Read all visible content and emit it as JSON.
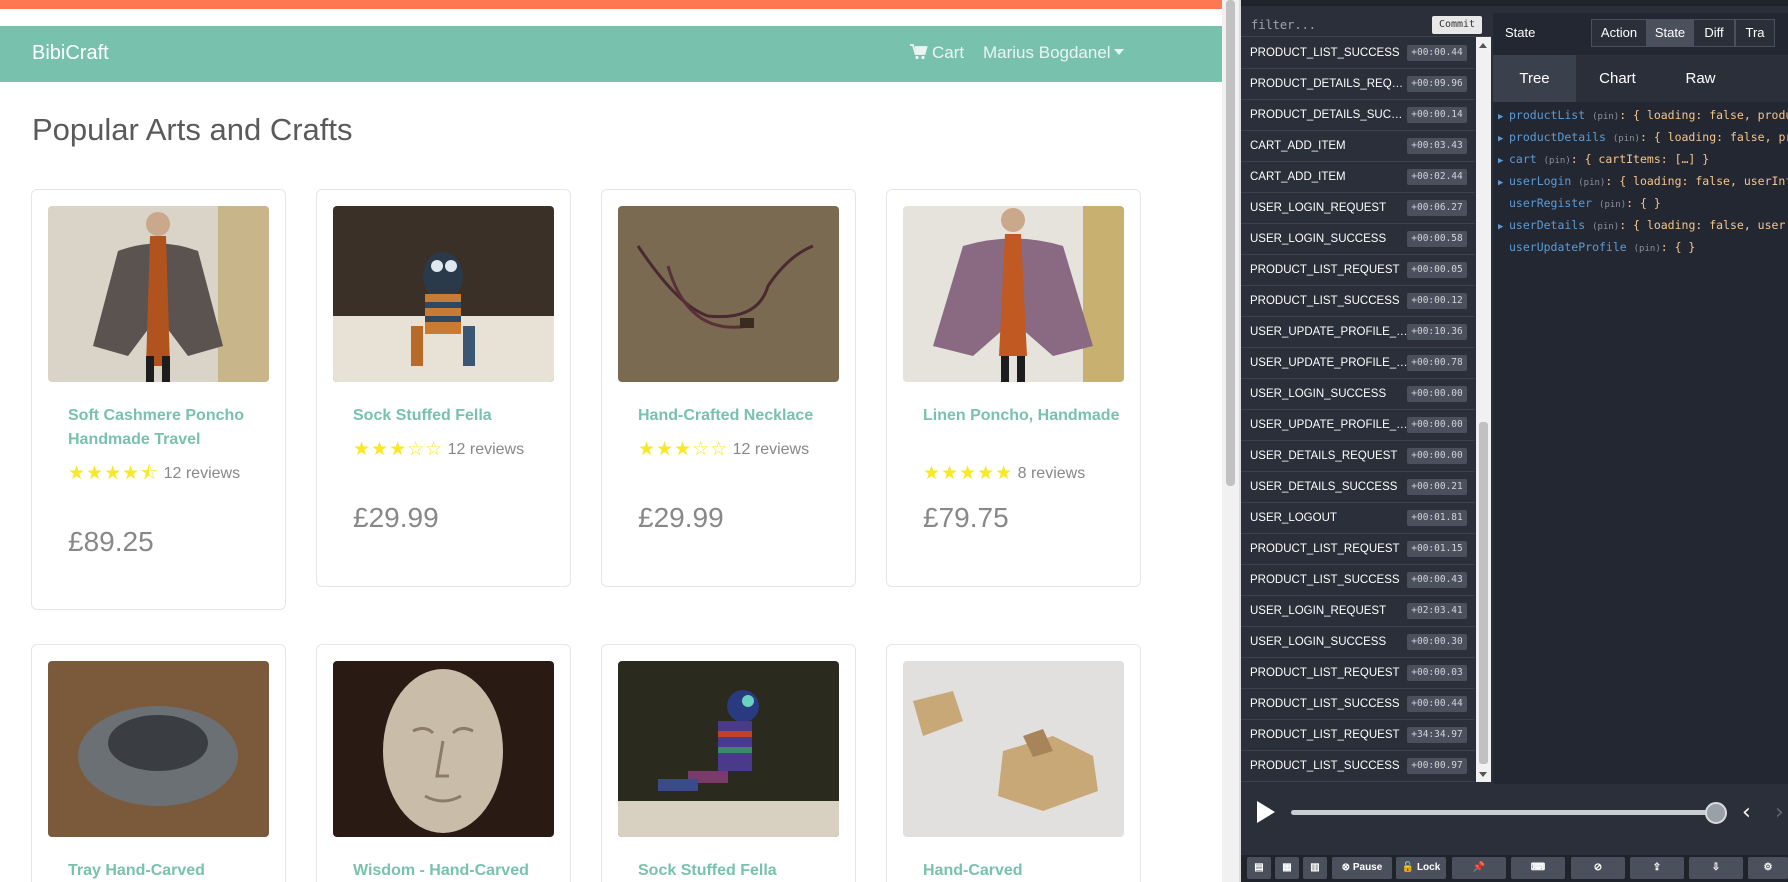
{
  "app": {
    "brand": "BibiCraft",
    "nav": {
      "cart_label": "Cart",
      "user_label": "Marius Bogdanel"
    },
    "page_title": "Popular Arts and Crafts",
    "products": [
      {
        "title": "Soft Cashmere Poncho Handmade Travel",
        "stars": "★★★★⯪",
        "reviews": "12 reviews",
        "price": "£89.25",
        "rating": 4.5
      },
      {
        "title": "Sock Stuffed Fella",
        "stars": "★★★☆☆",
        "reviews": "12 reviews",
        "price": "£29.99",
        "rating": 3
      },
      {
        "title": "Hand-Crafted Necklace",
        "stars": "★★★☆☆",
        "reviews": "12 reviews",
        "price": "£29.99",
        "rating": 3
      },
      {
        "title": "Linen Poncho, Handmade",
        "stars": "★★★★★",
        "reviews": "8 reviews",
        "price": "£79.75",
        "rating": 5
      },
      {
        "title": "Tray Hand-Carved"
      },
      {
        "title": "Wisdom - Hand-Carved"
      },
      {
        "title": "Sock Stuffed Fella"
      },
      {
        "title": "Hand-Carved"
      }
    ]
  },
  "devtools": {
    "filter_placeholder": "filter...",
    "commit_label": "Commit",
    "actions": [
      {
        "name": "PRODUCT_LIST_SUCCESS",
        "time": "+00:00.44"
      },
      {
        "name": "PRODUCT_DETAILS_REQUEST",
        "time": "+00:09.96"
      },
      {
        "name": "PRODUCT_DETAILS_SUCCESS",
        "time": "+00:00.14"
      },
      {
        "name": "CART_ADD_ITEM",
        "time": "+00:03.43"
      },
      {
        "name": "CART_ADD_ITEM",
        "time": "+00:02.44"
      },
      {
        "name": "USER_LOGIN_REQUEST",
        "time": "+00:06.27"
      },
      {
        "name": "USER_LOGIN_SUCCESS",
        "time": "+00:00.58"
      },
      {
        "name": "PRODUCT_LIST_REQUEST",
        "time": "+00:00.05"
      },
      {
        "name": "PRODUCT_LIST_SUCCESS",
        "time": "+00:00.12"
      },
      {
        "name": "USER_UPDATE_PROFILE_RE...",
        "time": "+00:10.36"
      },
      {
        "name": "USER_UPDATE_PROFILE_SU...",
        "time": "+00:00.78"
      },
      {
        "name": "USER_LOGIN_SUCCESS",
        "time": "+00:00.00"
      },
      {
        "name": "USER_UPDATE_PROFILE_RE...",
        "time": "+00:00.00"
      },
      {
        "name": "USER_DETAILS_REQUEST",
        "time": "+00:00.00"
      },
      {
        "name": "USER_DETAILS_SUCCESS",
        "time": "+00:00.21"
      },
      {
        "name": "USER_LOGOUT",
        "time": "+00:01.81"
      },
      {
        "name": "PRODUCT_LIST_REQUEST",
        "time": "+00:01.15"
      },
      {
        "name": "PRODUCT_LIST_SUCCESS",
        "time": "+00:00.43"
      },
      {
        "name": "USER_LOGIN_REQUEST",
        "time": "+02:03.41"
      },
      {
        "name": "USER_LOGIN_SUCCESS",
        "time": "+00:00.30"
      },
      {
        "name": "PRODUCT_LIST_REQUEST",
        "time": "+00:00.03"
      },
      {
        "name": "PRODUCT_LIST_SUCCESS",
        "time": "+00:00.44"
      },
      {
        "name": "PRODUCT_LIST_REQUEST",
        "time": "+34:34.97"
      },
      {
        "name": "PRODUCT_LIST_SUCCESS",
        "time": "+00:00.97"
      }
    ],
    "state_title": "State",
    "mode_tabs": [
      "Action",
      "State",
      "Diff",
      "Tra"
    ],
    "view_tabs": [
      "Tree",
      "Chart",
      "Raw"
    ],
    "tree": [
      {
        "arrow": "▶",
        "key": "productList",
        "pin": "(pin)",
        "value": ": { loading: false, product"
      },
      {
        "arrow": "▶",
        "key": "productDetails",
        "pin": "(pin)",
        "value": ": { loading: false, prod"
      },
      {
        "arrow": "▶",
        "key": "cart",
        "pin": "(pin)",
        "value": ": { cartItems: […] }"
      },
      {
        "arrow": "▶",
        "key": "userLogin",
        "pin": "(pin)",
        "value": ": { loading: false, userInfo:"
      },
      {
        "arrow": "",
        "key": "userRegister",
        "pin": "(pin)",
        "value": ": { }"
      },
      {
        "arrow": "▶",
        "key": "userDetails",
        "pin": "(pin)",
        "value": ": { loading: false, user: {"
      },
      {
        "arrow": "",
        "key": "userUpdateProfile",
        "pin": "(pin)",
        "value": ": { }"
      }
    ],
    "toolbar": {
      "pause_label": "Pause",
      "lock_label": "Lock"
    },
    "colors": {
      "accent": "#78c2ad",
      "top_strip": "#ff7851",
      "star": "#f8e825"
    }
  }
}
